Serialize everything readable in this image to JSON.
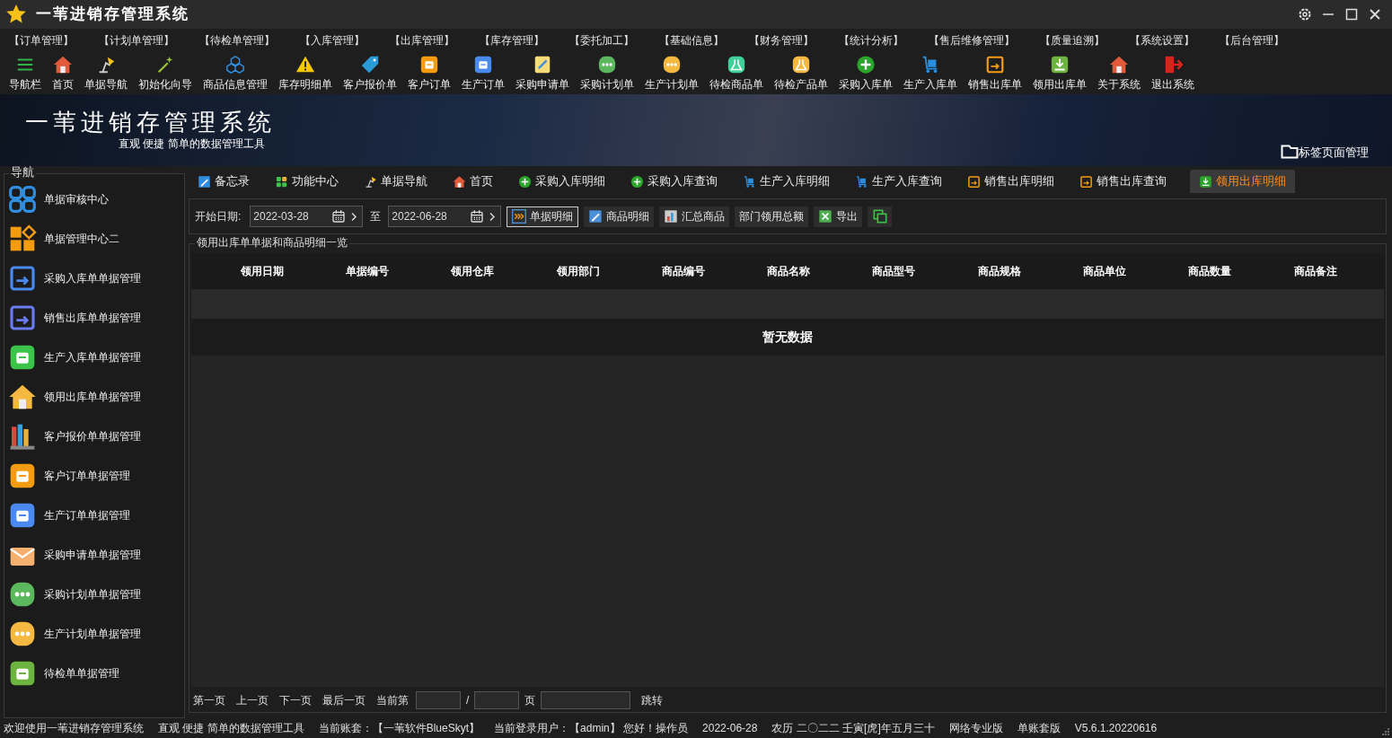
{
  "window": {
    "title": "一苇进销存管理系统"
  },
  "menu": [
    "【订单管理】",
    "【计划单管理】",
    "【待检单管理】",
    "【入库管理】",
    "【出库管理】",
    "【库存管理】",
    "【委托加工】",
    "【基础信息】",
    "【财务管理】",
    "【统计分析】",
    "【售后维修管理】",
    "【质量追溯】",
    "【系统设置】",
    "【后台管理】"
  ],
  "toolbar": [
    "导航栏",
    "首页",
    "单据导航",
    "初始化向导",
    "商品信息管理",
    "库存明细单",
    "客户报价单",
    "客户订单",
    "生产订单",
    "采购申请单",
    "采购计划单",
    "生产计划单",
    "待检商品单",
    "待检产品单",
    "采购入库单",
    "生产入库单",
    "销售出库单",
    "领用出库单",
    "关于系统",
    "退出系统"
  ],
  "banner": {
    "title": "一苇进销存管理系统",
    "subtitle": "直观 便捷 简单的数据管理工具",
    "tab_manager": "标签页面管理"
  },
  "sidebar": {
    "title": "导航",
    "items": [
      "单据审核中心",
      "单据管理中心二",
      "采购入库单单据管理",
      "销售出库单单据管理",
      "生产入库单单据管理",
      "领用出库单单据管理",
      "客户报价单单据管理",
      "客户订单单据管理",
      "生产订单单据管理",
      "采购申请单单据管理",
      "采购计划单单据管理",
      "生产计划单单据管理",
      "待检单单据管理"
    ]
  },
  "tabs": [
    {
      "label": "备忘录",
      "selected": false
    },
    {
      "label": "功能中心",
      "selected": false
    },
    {
      "label": "单据导航",
      "selected": false
    },
    {
      "label": "首页",
      "selected": false
    },
    {
      "label": "采购入库明细",
      "selected": false
    },
    {
      "label": "采购入库查询",
      "selected": false
    },
    {
      "label": "生产入库明细",
      "selected": false
    },
    {
      "label": "生产入库查询",
      "selected": false
    },
    {
      "label": "销售出库明细",
      "selected": false
    },
    {
      "label": "销售出库查询",
      "selected": false
    },
    {
      "label": "领用出库明细",
      "selected": true
    }
  ],
  "filter": {
    "start_label": "开始日期:",
    "start_date": "2022-03-28",
    "to_label": "至",
    "end_date": "2022-06-28",
    "buttons": [
      "单据明细",
      "商品明细",
      "汇总商品",
      "部门领用总额",
      "导出"
    ]
  },
  "table": {
    "title": "领用出库单单据和商品明细一览",
    "columns": [
      "领用日期",
      "单据编号",
      "领用仓库",
      "领用部门",
      "商品编号",
      "商品名称",
      "商品型号",
      "商品规格",
      "商品单位",
      "商品数量",
      "商品备注"
    ],
    "empty_text": "暂无数据"
  },
  "pager": {
    "first": "第一页",
    "prev": "上一页",
    "next": "下一页",
    "last": "最后一页",
    "current_label": "当前第",
    "slash": "/",
    "page_label": "页",
    "jump": "跳转"
  },
  "status_bar": [
    "欢迎使用一苇进销存管理系统",
    "直观 便捷 简单的数据管理工具",
    "当前账套：【一苇软件BlueSkyt】",
    "当前登录用户：【admin】 您好！操作员",
    "2022-06-28",
    "农历 二〇二二 壬寅[虎]年五月三十",
    "网络专业版",
    "单账套版",
    "V5.6.1.20220616"
  ]
}
